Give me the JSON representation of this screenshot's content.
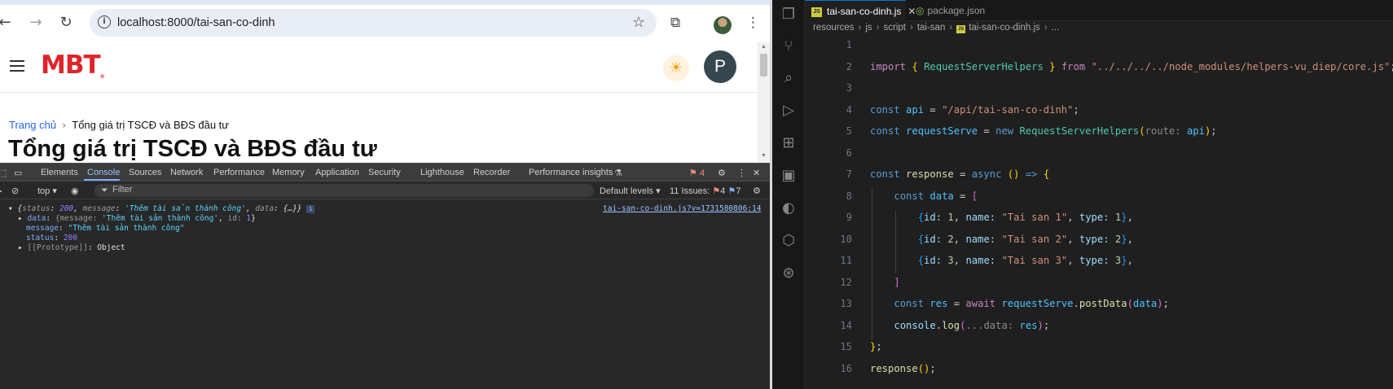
{
  "browser": {
    "url": "localhost:8000/tai-san-co-dinh",
    "icons": {
      "back": "back-arrow-icon",
      "forward": "forward-arrow-icon",
      "reload": "reload-icon",
      "info": "site-info-icon",
      "bookmark": "star-icon",
      "extensions": "puzzle-icon",
      "menu": "kebab-menu-icon"
    }
  },
  "site": {
    "logo": "MBT",
    "logo_mark": "®",
    "avatar_letter": "P",
    "breadcrumb": {
      "home": "Trang chủ",
      "current": "Tổng giá trị TSCĐ và BĐS đầu tư"
    },
    "title": "Tổng giá trị TSCĐ và BĐS đầu tư"
  },
  "devtools": {
    "tabs": [
      "Elements",
      "Console",
      "Sources",
      "Network",
      "Performance",
      "Memory",
      "Application",
      "Security",
      "Lighthouse",
      "Recorder",
      "Performance insights"
    ],
    "active_tab": "Console",
    "errors_badge": "4",
    "context": "top",
    "filter_placeholder": "Filter",
    "levels": "Default levels",
    "issues_label": "11 Issues:",
    "issues_errors": "4",
    "issues_info": "7",
    "source_link": "tai-san-co-dinh.js?v=1731580806:14",
    "log": {
      "summary_open": "{",
      "k_status": "status",
      "v_status": "200",
      "k_message": "message",
      "v_message": "'Thêm tài sản thành công'",
      "k_data": "data",
      "v_data": "{…}",
      "summary_close": "}",
      "data_line_key": "data",
      "data_line_val_open": "{message:",
      "data_line_msg": "'Thêm tài sản thành công'",
      "data_line_id": "id:",
      "data_line_id_val": "1",
      "message_key": "message",
      "message_val": "\"Thêm tài sản thành công\"",
      "status_key": "status",
      "status_val": "200",
      "proto_key": "[[Prototype]]",
      "proto_val": "Object"
    }
  },
  "vscode": {
    "tabs": [
      {
        "label": "tai-san-co-dinh.js",
        "active": true
      },
      {
        "label": "package.json",
        "active": false
      }
    ],
    "breadcrumb": [
      "resources",
      "js",
      "script",
      "tai-san",
      "tai-san-co-dinh.js",
      "..."
    ],
    "line_numbers": [
      "1",
      "2",
      "3",
      "4",
      "5",
      "6",
      "7",
      "8",
      "9",
      "10",
      "11",
      "12",
      "13",
      "14",
      "15",
      "16"
    ],
    "code": {
      "l2_import": "import",
      "l2_name": "RequestServerHelpers",
      "l2_from": "from",
      "l2_path": "\"../../../../node_modules/helpers-vu_diep/core.js\"",
      "l4_const": "const",
      "l4_var": "api",
      "l4_val": "\"/api/tai-san-co-dinh\"",
      "l5_const": "const",
      "l5_var": "requestServe",
      "l5_new": "new",
      "l5_class": "RequestServerHelpers",
      "l5_hint": "route:",
      "l5_arg": "api",
      "l7_const": "const",
      "l7_var": "response",
      "l7_async": "async",
      "l8_const": "const",
      "l8_var": "data",
      "rows": [
        {
          "id_key": "id:",
          "id": "1",
          "name_key": "name:",
          "name": "\"Tai san 1\"",
          "type_key": "type:",
          "type": "1"
        },
        {
          "id_key": "id:",
          "id": "2",
          "name_key": "name:",
          "name": "\"Tai san 2\"",
          "type_key": "type:",
          "type": "2"
        },
        {
          "id_key": "id:",
          "id": "3",
          "name_key": "name:",
          "name": "\"Tai san 3\"",
          "type_key": "type:",
          "type": "3"
        }
      ],
      "l13_const": "const",
      "l13_var": "res",
      "l13_await": "await",
      "l13_obj": "requestServe",
      "l13_fn": "postData",
      "l13_arg": "data",
      "l14_obj": "console",
      "l14_fn": "log",
      "l14_hint": "...data:",
      "l14_arg": "res",
      "l16_fn": "response"
    }
  }
}
